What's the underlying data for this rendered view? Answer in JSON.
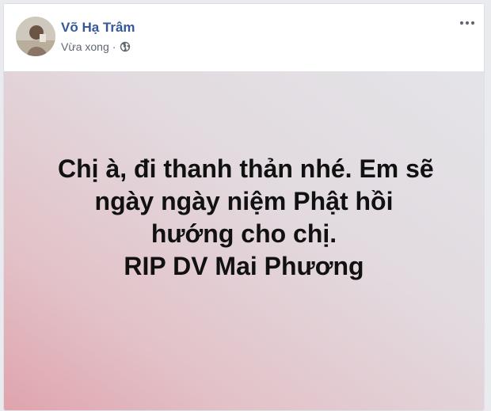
{
  "post": {
    "author": {
      "name": "Võ Hạ Trâm",
      "avatar_icon": "avatar-photo"
    },
    "timestamp": "Vừa xong",
    "separator": "·",
    "privacy_icon": "globe-icon",
    "more_icon": "more-options-icon",
    "background_colors": {
      "top_right": "#e4e4e8",
      "bottom_left": "#e0a3ad"
    },
    "text_lines": [
      "Chị à, đi thanh thản nhé. Em sẽ",
      "ngày ngày niệm Phật hồi",
      "hướng cho chị.",
      "RIP DV Mai Phương"
    ]
  },
  "colors": {
    "name": "#365899",
    "meta": "#616770",
    "text": "#111111"
  }
}
